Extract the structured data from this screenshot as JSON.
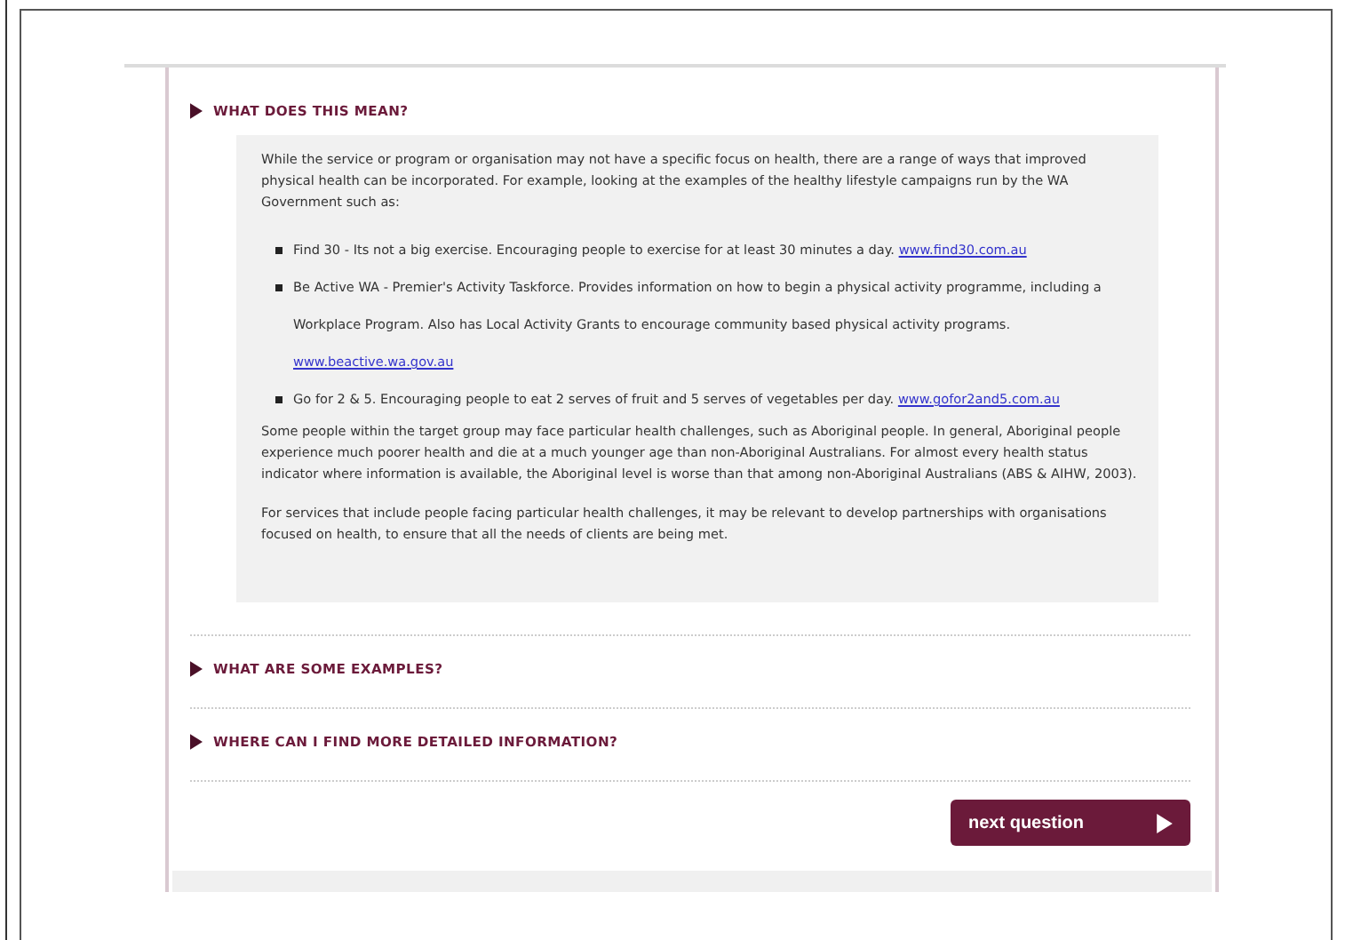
{
  "sections": [
    {
      "title": "WHAT DOES THIS MEAN?",
      "expanded": true,
      "content": [
        {
          "kind": "paragraph",
          "text": "While the service or program or organisation may not have a specific focus on health, there are a range of ways that improved physical health can be incorporated. For example, looking at the examples of the healthy lifestyle campaigns run by the WA Government such as:"
        },
        {
          "kind": "bullets",
          "items": [
            {
              "text": "Find 30 - Its not a big exercise. Encouraging people to exercise for at least 30 minutes a day.",
              "link": "www.find30.com.au"
            },
            {
              "text": "Be Active WA - Premier's Activity Taskforce. Provides information on how to begin a physical activity programme, including a Workplace Program. Also has Local Activity Grants to encourage community based physical activity programs.",
              "link": "www.beactive.wa.gov.au"
            },
            {
              "text": "Go for 2 & 5. Encouraging people to eat 2 serves of fruit and 5 serves of vegetables per day.",
              "link": "www.gofor2and5.com.au"
            }
          ]
        },
        {
          "kind": "paragraph",
          "text": "Some people within the target group may face particular health challenges, such as Aboriginal people. In general, Aboriginal people experience much poorer health and die at a much younger age than non-Aboriginal Australians. For almost every health status indicator where information is available, the Aboriginal level is worse than that among non-Aboriginal Australians (ABS & AIHW, 2003)."
        },
        {
          "kind": "paragraph",
          "text": "For services that include people facing particular health challenges, it may be relevant to develop partnerships with organisations focused on health, to ensure that all the needs of clients are being met."
        }
      ]
    },
    {
      "title": "WHAT ARE SOME EXAMPLES?"
    },
    {
      "title": "WHERE CAN I FIND MORE DETAILED INFORMATION?"
    }
  ],
  "next_button": {
    "label": "next question"
  }
}
